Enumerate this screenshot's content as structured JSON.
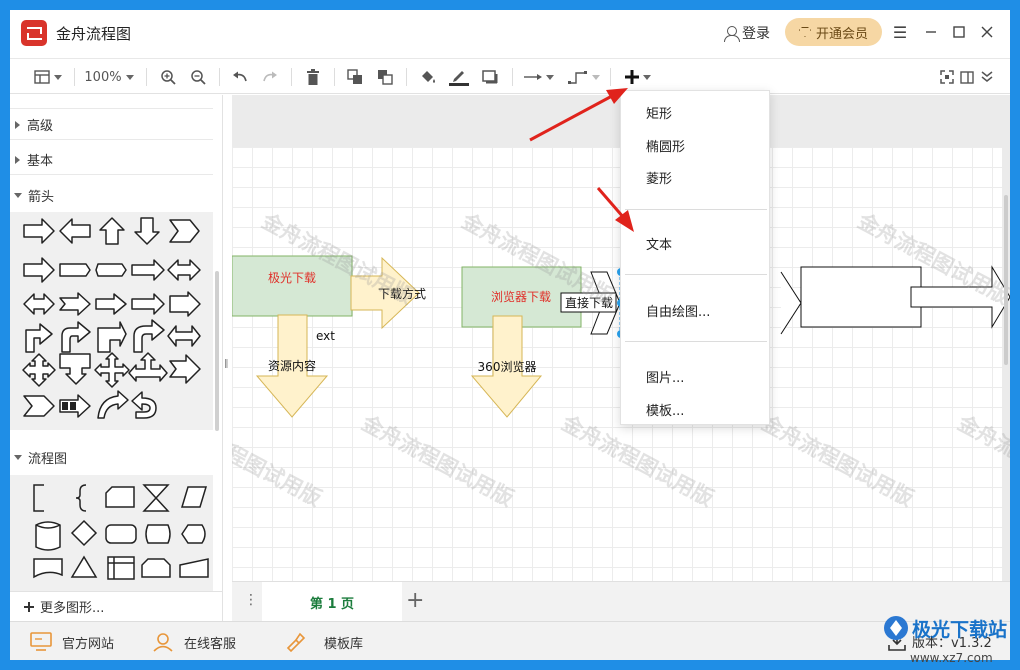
{
  "app": {
    "title": "金舟流程图"
  },
  "titlebar": {
    "login_label": "登录",
    "vip_label": "开通会员"
  },
  "toolbar": {
    "zoom": "100%"
  },
  "sidebar": {
    "categories": [
      "高级",
      "基本",
      "箭头",
      "流程图"
    ],
    "more_shapes": "更多图形..."
  },
  "diagram": {
    "nodes": [
      "极光下载",
      "浏览器下载"
    ],
    "labels": [
      "下载方式",
      "直接下载",
      "资源内容",
      "360浏览器",
      "ext"
    ]
  },
  "watermark": "金舟流程图试用版",
  "insert_menu": {
    "items": [
      "矩形",
      "椭圆形",
      "菱形",
      "文本",
      "自由绘图...",
      "图片...",
      "模板..."
    ]
  },
  "pages": {
    "tab_label": "第 1 页"
  },
  "statusbar": {
    "website": "官方网站",
    "support": "在线客服",
    "templates": "模板库",
    "version": "版本：v1.3.2"
  },
  "corner_logo": {
    "title": "极光下载站",
    "url": "www.xz7.com"
  },
  "colors": {
    "accent_red": "#d9342b",
    "node_fill": "#d5e8d4",
    "node_stroke": "#82b366",
    "arrow_fill": "#fff2cc",
    "arrow_stroke": "#d6b656",
    "node_text": "#e0302a",
    "selection": "#29a3f0",
    "vip_bg": "#f6d7a4"
  }
}
